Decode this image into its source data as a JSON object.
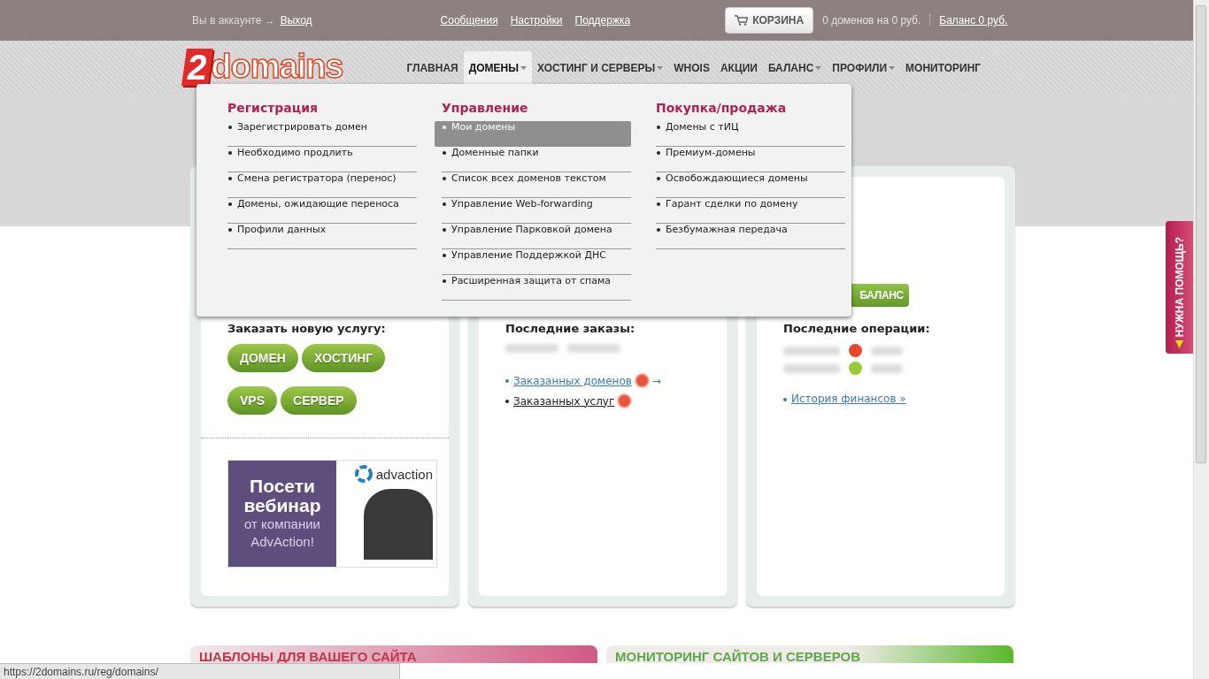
{
  "account": {
    "label": "Вы в аккаунте →",
    "logout": "Выход"
  },
  "top_links": [
    "Сообщения",
    "Настройки",
    "Поддержка"
  ],
  "cart": {
    "button": "КОРЗИНА",
    "summary": "0 доменов на 0 руб.",
    "balance": "Баланс 0 руб."
  },
  "logo": {
    "digit": "2",
    "text": "domains"
  },
  "nav": [
    {
      "label": "ГЛАВНАЯ",
      "selected": false,
      "dropdown": false
    },
    {
      "label": "ДОМЕНЫ",
      "selected": true,
      "dropdown": true
    },
    {
      "label": "ХОСТИНГ И СЕРВЕРЫ",
      "selected": false,
      "dropdown": true
    },
    {
      "label": "WHOIS",
      "selected": false,
      "dropdown": false
    },
    {
      "label": "АКЦИИ",
      "selected": false,
      "dropdown": false
    },
    {
      "label": "БАЛАНС",
      "selected": false,
      "dropdown": true
    },
    {
      "label": "ПРОФИЛИ",
      "selected": false,
      "dropdown": true
    },
    {
      "label": "МОНИТОРИНГ",
      "selected": false,
      "dropdown": false
    }
  ],
  "menu": {
    "columns": [
      {
        "heading": "Регистрация",
        "items": [
          {
            "label": "Зарегистрировать домен",
            "selected": false
          },
          {
            "label": "Необходимо продлить",
            "selected": false
          },
          {
            "label": "Смена регистратора (перенос)",
            "selected": false
          },
          {
            "label": "Домены, ожидающие переноса",
            "selected": false
          },
          {
            "label": "Профили данных",
            "selected": false
          }
        ]
      },
      {
        "heading": "Управление",
        "items": [
          {
            "label": "Мои домены",
            "selected": true
          },
          {
            "label": "Доменные папки",
            "selected": false
          },
          {
            "label": "Список всех доменов текстом",
            "selected": false
          },
          {
            "label": "Управление Web-forwarding",
            "selected": false
          },
          {
            "label": "Управление Парковкой домена",
            "selected": false
          },
          {
            "label": "Управление Поддержкой ДНС",
            "selected": false
          },
          {
            "label": "Расширенная защита от спама",
            "selected": false
          }
        ]
      },
      {
        "heading": "Покупка/продажа",
        "items": [
          {
            "label": "Домены с тИЦ",
            "selected": false
          },
          {
            "label": "Премиум-домены",
            "selected": false
          },
          {
            "label": "Освобождающиеся домены",
            "selected": false
          },
          {
            "label": "Гарант сделки по домену",
            "selected": false
          },
          {
            "label": "Безбумажная передача",
            "selected": false
          }
        ]
      }
    ]
  },
  "order_card": {
    "title": "Заказать новую услугу:",
    "button_rows": [
      [
        "ДОМЕН",
        "ХОСТИНГ"
      ],
      [
        "VPS",
        "СЕРВЕР"
      ]
    ]
  },
  "banner": {
    "headline": [
      "Посети",
      "вебинар"
    ],
    "subline": [
      "от компании",
      "AdvAction!"
    ],
    "brand": "advaction"
  },
  "orders_card": {
    "title": "Последние заказы:",
    "links": [
      {
        "label": "Заказанных доменов",
        "kind": "highlight",
        "arrow": "→"
      },
      {
        "label": "Заказанных услуг",
        "kind": "plain"
      }
    ]
  },
  "finance_card": {
    "button": "БАЛАНС",
    "title": "Последние операции:",
    "operations": [
      {
        "color": "#e8462a"
      },
      {
        "color": "#99cc33"
      }
    ],
    "link": "История финансов »"
  },
  "promos": [
    {
      "title": "ШАБЛОНЫ ДЛЯ ВАШЕГО САЙТА",
      "kind": "templates"
    },
    {
      "title": "МОНИТОРИНГ САЙТОВ И СЕРВЕРОВ",
      "kind": "monitoring"
    }
  ],
  "help_tab": {
    "label": "НУЖНА ПОМОЩЬ?"
  },
  "status_bar": {
    "url": "https://2domains.ru/reg/domains/"
  }
}
